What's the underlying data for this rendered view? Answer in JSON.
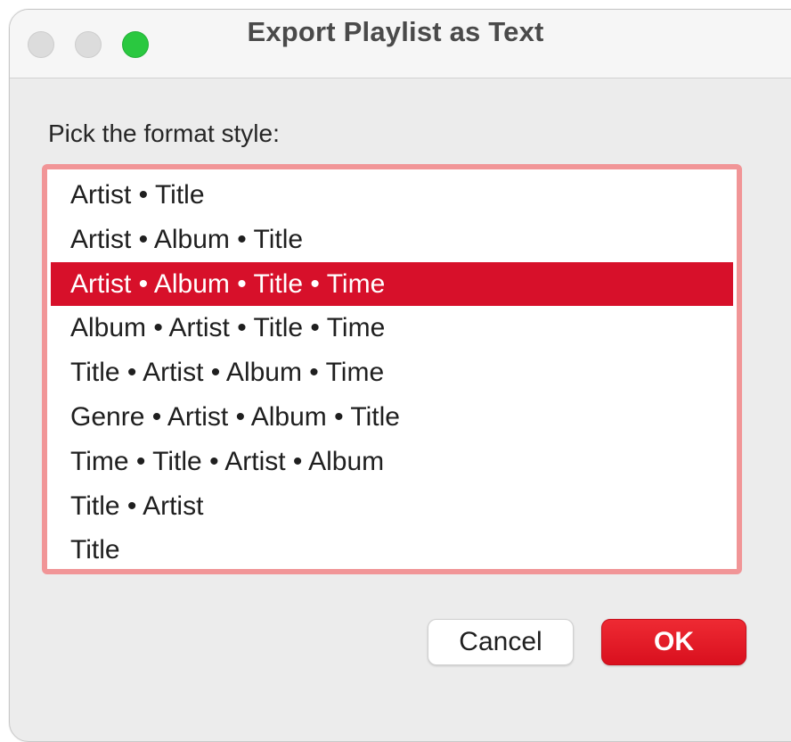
{
  "window": {
    "title": "Export Playlist as Text",
    "traffic_lights": {
      "close": {
        "icon": "close-dot-icon",
        "color": "#dcdcdc"
      },
      "minimize": {
        "icon": "minimize-dot-icon",
        "color": "#dcdcdc"
      },
      "zoom": {
        "icon": "zoom-dot-icon",
        "color": "#2ac840"
      }
    }
  },
  "dialog": {
    "prompt": "Pick the format style:",
    "formats": [
      "Artist • Title",
      "Artist • Album • Title",
      "Artist • Album • Title • Time",
      "Album • Artist • Title • Time",
      "Title • Artist • Album • Time",
      "Genre • Artist • Album • Title",
      "Time • Title • Artist • Album",
      "Title • Artist",
      "Title"
    ],
    "selected_index": 2,
    "cancel_label": "Cancel",
    "ok_label": "OK"
  },
  "colors": {
    "accent": "#d7102a",
    "focus_ring": "#f19597",
    "ok_button": "#e21b26"
  }
}
